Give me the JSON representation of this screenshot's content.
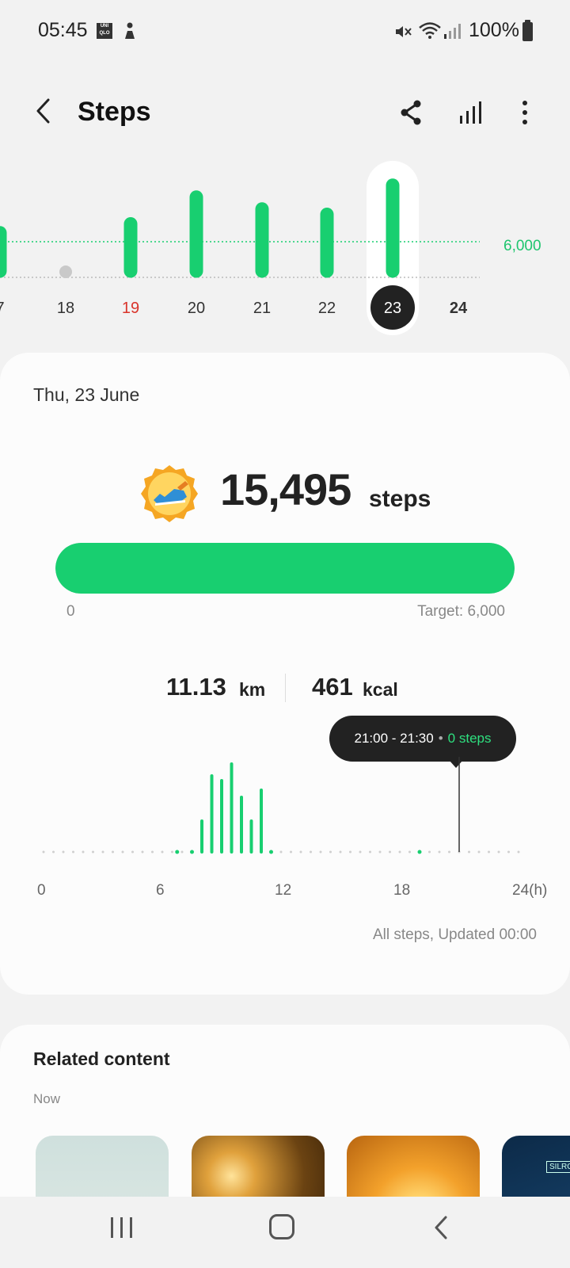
{
  "status_bar": {
    "time": "05:45",
    "uniqlo_icon": "UNI QLO",
    "battery": "100%"
  },
  "app_bar": {
    "title": "Steps",
    "back_icon": "back-arrow-icon",
    "share_icon": "share-icon",
    "chart_icon": "bar-chart-icon",
    "more_icon": "more-vertical-icon"
  },
  "colors": {
    "accent": "#18cf70",
    "weekend_red": "#d9342b",
    "dark": "#222222"
  },
  "week_chart": {
    "goal_label": "6,000",
    "days": [
      {
        "label": "7",
        "steps": 7500,
        "style": "normal"
      },
      {
        "label": "18",
        "steps": 0,
        "style": "normal"
      },
      {
        "label": "19",
        "steps": 9000,
        "style": "sunday"
      },
      {
        "label": "20",
        "steps": 13500,
        "style": "normal"
      },
      {
        "label": "21",
        "steps": 11500,
        "style": "normal"
      },
      {
        "label": "22",
        "steps": 10600,
        "style": "normal"
      },
      {
        "label": "23",
        "steps": 15495,
        "style": "selected"
      },
      {
        "label": "24",
        "steps": null,
        "style": "today"
      }
    ]
  },
  "summary": {
    "date": "Thu, 23 June",
    "medal_icon": "running-shoe-medal-icon",
    "steps": "15,495",
    "steps_unit": "steps",
    "progress_fraction": 1.0,
    "progress_start": "0",
    "target": "Target: 6,000",
    "distance_value": "11.13",
    "distance_unit": "km",
    "calories_value": "461",
    "calories_unit": "kcal",
    "tooltip_range": "21:00 - 21:30",
    "tooltip_sep": "•",
    "tooltip_steps": "0 steps",
    "updated": "All steps, Updated 00:00"
  },
  "chart_data": {
    "type": "bar",
    "xlabel_ticks": [
      "0",
      "6",
      "12",
      "18",
      "24(h)"
    ],
    "x_unit": "hour",
    "bar_width_hours": 0.5,
    "bars": [
      {
        "x": 8.0,
        "steps": 650
      },
      {
        "x": 8.5,
        "steps": 1600
      },
      {
        "x": 9.0,
        "steps": 1500
      },
      {
        "x": 9.5,
        "steps": 1850
      },
      {
        "x": 10.0,
        "steps": 1150
      },
      {
        "x": 10.5,
        "steps": 650
      },
      {
        "x": 11.0,
        "steps": 1300
      }
    ],
    "small_points_hours": [
      6.75,
      7.5,
      11.5,
      19.0
    ],
    "selected_hour": 21.0,
    "ylim": [
      0,
      2000
    ]
  },
  "related": {
    "title": "Related content",
    "subtitle": "Now",
    "thumb_4_label": "SILRCG"
  },
  "nav": {
    "recents_icon": "recents-icon",
    "home_icon": "home-icon",
    "back_icon": "nav-back-icon"
  }
}
